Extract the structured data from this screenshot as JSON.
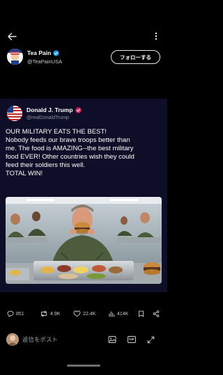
{
  "post": {
    "author_name": "Tea Pain",
    "author_handle": "@TeaPainUSA",
    "follow_label": "フォローする"
  },
  "quoted": {
    "author_name": "Donald J. Trump",
    "author_handle": "@realDonaldTrump",
    "text_lines": [
      "OUR MILITARY EATS THE BEST!",
      "Nobody feeds our brave troops better than",
      "me. The food is AMAZING--the best military",
      "food EVER! Other countries wish they could",
      "feed their soldiers this well.",
      "TOTAL WIN!"
    ]
  },
  "actions": {
    "replies": "851",
    "reposts": "4.9K",
    "likes": "22.4K",
    "views": "414K"
  },
  "reply_bar": {
    "placeholder": "返信をポスト"
  },
  "icons": {
    "back": "arrow-left-icon",
    "more": "more-vertical-icon",
    "verified": "verified-badge-icon",
    "reply": "speech-bubble-icon",
    "repost": "repost-icon",
    "like": "heart-icon",
    "views": "bar-chart-icon",
    "bookmark": "bookmark-icon",
    "share": "share-icon",
    "image": "image-icon",
    "gif": "gif-icon",
    "expand": "expand-icon"
  },
  "colors": {
    "background": "#000000",
    "verified_blue": "#1d9bf0",
    "verified_pink": "#e0245e",
    "media_background": "#0e0e28",
    "muted_text": "#c8ccd0"
  }
}
